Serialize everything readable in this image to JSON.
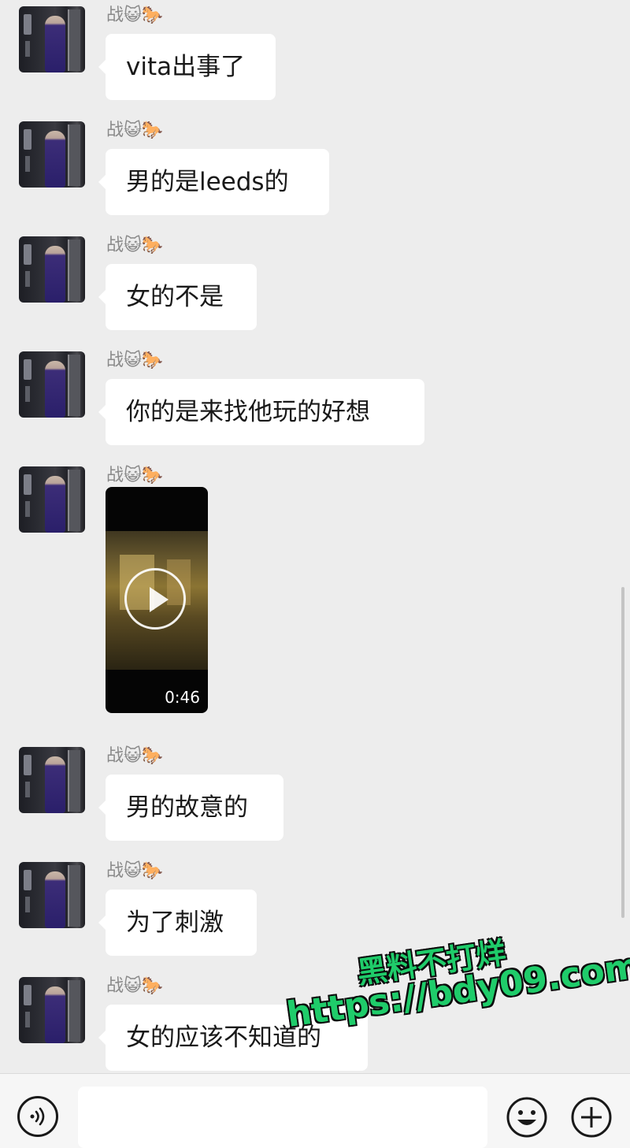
{
  "chat": {
    "sender_name": "战😺🐎",
    "messages": [
      {
        "type": "text",
        "text": "vita出事了"
      },
      {
        "type": "text",
        "text": "男的是leeds的"
      },
      {
        "type": "text",
        "text": "女的不是"
      },
      {
        "type": "text",
        "text": "你的是来找他玩的好想"
      },
      {
        "type": "video",
        "duration": "0:46",
        "icon": "play-icon"
      },
      {
        "type": "text",
        "text": "男的故意的"
      },
      {
        "type": "text",
        "text": "为了刺激"
      },
      {
        "type": "text",
        "text": "女的应该不知道的"
      }
    ]
  },
  "watermark": {
    "line1": "黑料不打烊",
    "line2": "https://bdy09.com"
  },
  "input_bar": {
    "input_value": "",
    "icons": [
      "voice-icon",
      "emoji-icon",
      "plus-icon"
    ]
  },
  "colors": {
    "background": "#ededed",
    "bubble": "#ffffff",
    "name_text": "#8a8a8a",
    "watermark": "#1fcc6a"
  }
}
